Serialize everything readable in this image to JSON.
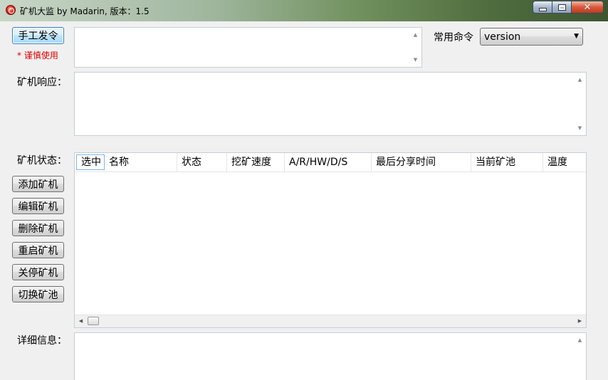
{
  "window": {
    "title": "矿机大监 by Madarin, 版本：1.5"
  },
  "manual": {
    "button_label": "手工发令",
    "warning": "* 谨慎使用",
    "command_input": ""
  },
  "common_command": {
    "label": "常用命令",
    "selected": "version"
  },
  "response": {
    "label": "矿机响应：",
    "text": ""
  },
  "status": {
    "label": "矿机状态：",
    "columns": [
      "选中",
      "名称",
      "状态",
      "挖矿速度",
      "A/R/HW/D/S",
      "最后分享时间",
      "当前矿池",
      "温度"
    ],
    "rows": []
  },
  "actions": {
    "add": "添加矿机",
    "edit": "编辑矿机",
    "delete": "删除矿机",
    "restart": "重启矿机",
    "stop": "关停矿机",
    "switch_pool": "切换矿池"
  },
  "details": {
    "label": "详细信息：",
    "text": ""
  },
  "colors": {
    "warning": "#e00000",
    "focus_border": "#3c7fb1"
  }
}
